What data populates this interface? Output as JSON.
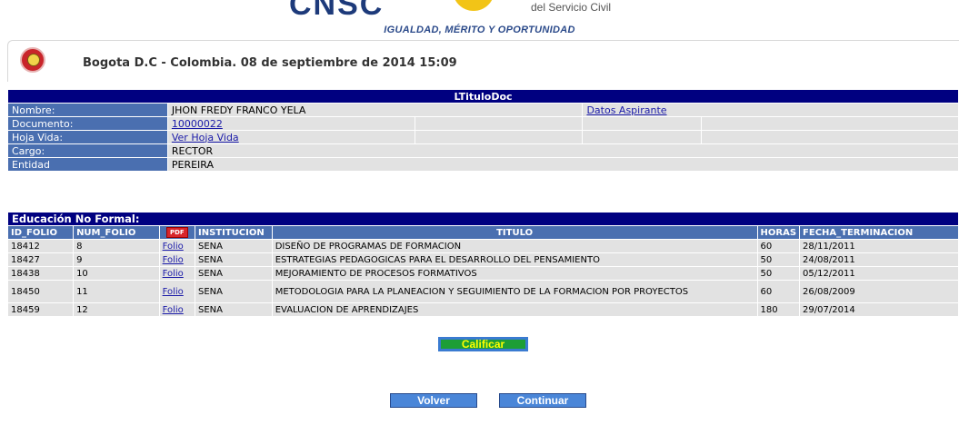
{
  "banner": {
    "logo_text": "CNSC",
    "subtext": "del Servicio Civil",
    "motto": "IGUALDAD, MÉRITO Y OPORTUNIDAD"
  },
  "header": {
    "date_line": "Bogota D.C - Colombia. 08 de septiembre de 2014 15:09"
  },
  "info": {
    "title": "LTituloDoc",
    "nombre_label": "Nombre:",
    "nombre_value": "JHON FREDY FRANCO YELA",
    "datos_link": "Datos Aspirante",
    "documento_label": "Documento:",
    "documento_value": "10000022",
    "hoja_label": "Hoja Vida:",
    "hoja_link": "Ver Hoja Vida",
    "cargo_label": "Cargo:",
    "cargo_value": "RECTOR",
    "entidad_label": "Entidad",
    "entidad_value": "PEREIRA"
  },
  "education": {
    "caption": "Educación No Formal:",
    "headers": {
      "id_folio": "ID_FOLIO",
      "num_folio": "NUM_FOLIO",
      "pdf": "PDF",
      "institucion": "INSTITUCION",
      "titulo": "TITULO",
      "horas": "HORAS",
      "fecha": "FECHA_TERMINACION"
    },
    "rows": [
      {
        "id": "18412",
        "num": "8",
        "folio": "Folio",
        "inst": "SENA",
        "titulo": "DISEÑO DE PROGRAMAS DE FORMACION",
        "horas": "60",
        "fecha": "28/11/2011"
      },
      {
        "id": "18427",
        "num": "9",
        "folio": "Folio",
        "inst": "SENA",
        "titulo": "ESTRATEGIAS PEDAGOGICAS PARA EL DESARROLLO DEL PENSAMIENTO",
        "horas": "50",
        "fecha": "24/08/2011"
      },
      {
        "id": "18438",
        "num": "10",
        "folio": "Folio",
        "inst": "SENA",
        "titulo": "MEJORAMIENTO DE PROCESOS FORMATIVOS",
        "horas": "50",
        "fecha": "05/12/2011"
      },
      {
        "id": "18450",
        "num": "11",
        "folio": "Folio",
        "inst": "SENA",
        "titulo": "METODOLOGIA PARA LA PLANEACION Y SEGUIMIENTO DE LA FORMACION POR PROYECTOS",
        "horas": "60",
        "fecha": "26/08/2009"
      },
      {
        "id": "18459",
        "num": "12",
        "folio": "Folio",
        "inst": "SENA",
        "titulo": "EVALUACION DE APRENDIZAJES",
        "horas": "180",
        "fecha": "29/07/2014"
      }
    ]
  },
  "buttons": {
    "calificar": "Calificar",
    "volver": "Volver",
    "continuar": "Continuar"
  }
}
